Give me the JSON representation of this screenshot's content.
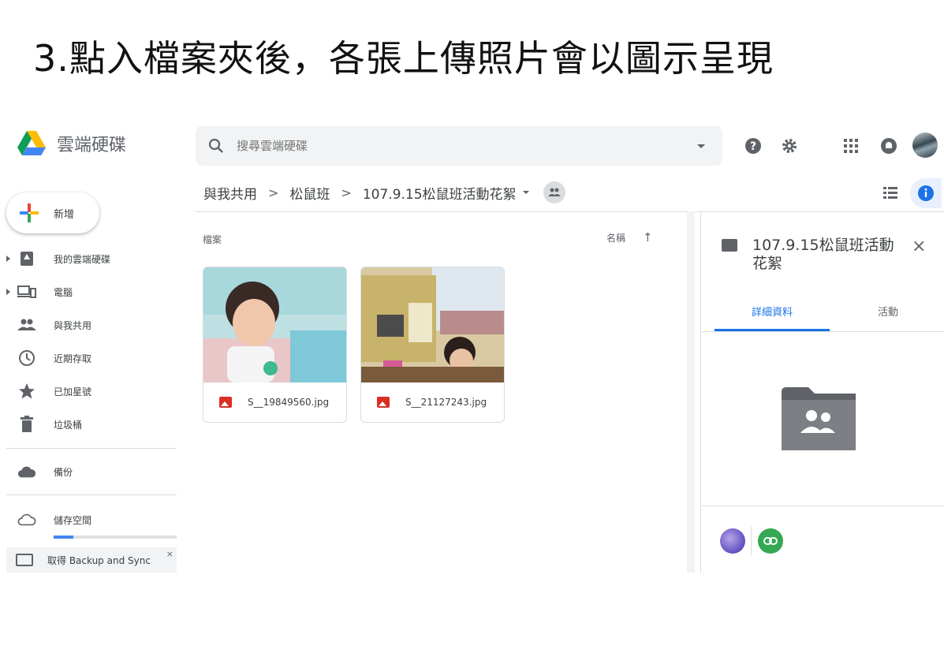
{
  "slide": {
    "title": "3.點入檔案夾後，各張上傳照片會以圖示呈現"
  },
  "app": {
    "name": "雲端硬碟"
  },
  "search": {
    "placeholder": "搜尋雲端硬碟"
  },
  "breadcrumb": [
    "與我共用",
    "松鼠班",
    "107.9.15松鼠班活動花絮"
  ],
  "new_button": {
    "label": "新增"
  },
  "sidebar": {
    "items": [
      {
        "label": "我的雲端硬碟",
        "icon": "my-drive-icon"
      },
      {
        "label": "電腦",
        "icon": "computer-icon"
      },
      {
        "label": "與我共用",
        "icon": "shared-icon"
      },
      {
        "label": "近期存取",
        "icon": "clock-icon"
      },
      {
        "label": "已加星號",
        "icon": "star-icon"
      },
      {
        "label": "垃圾桶",
        "icon": "trash-icon"
      }
    ],
    "backup": {
      "label": "備份"
    },
    "storage": {
      "label": "儲存空間",
      "used_fraction": 0.16
    },
    "promo": {
      "label": "取得 Backup and Sync",
      "close": "×"
    }
  },
  "main": {
    "section_label": "檔案",
    "sort_label": "名稱",
    "sort_arrow": "↑",
    "files": [
      {
        "name": "S__19849560.jpg"
      },
      {
        "name": "S__21127243.jpg"
      }
    ]
  },
  "details_panel": {
    "title": "107.9.15松鼠班活動花絮",
    "close": "×",
    "tabs": [
      "詳細資料",
      "活動"
    ]
  },
  "colors": {
    "accent": "#1a73e8",
    "file_icon": "#d93025",
    "link": "#34a853"
  }
}
